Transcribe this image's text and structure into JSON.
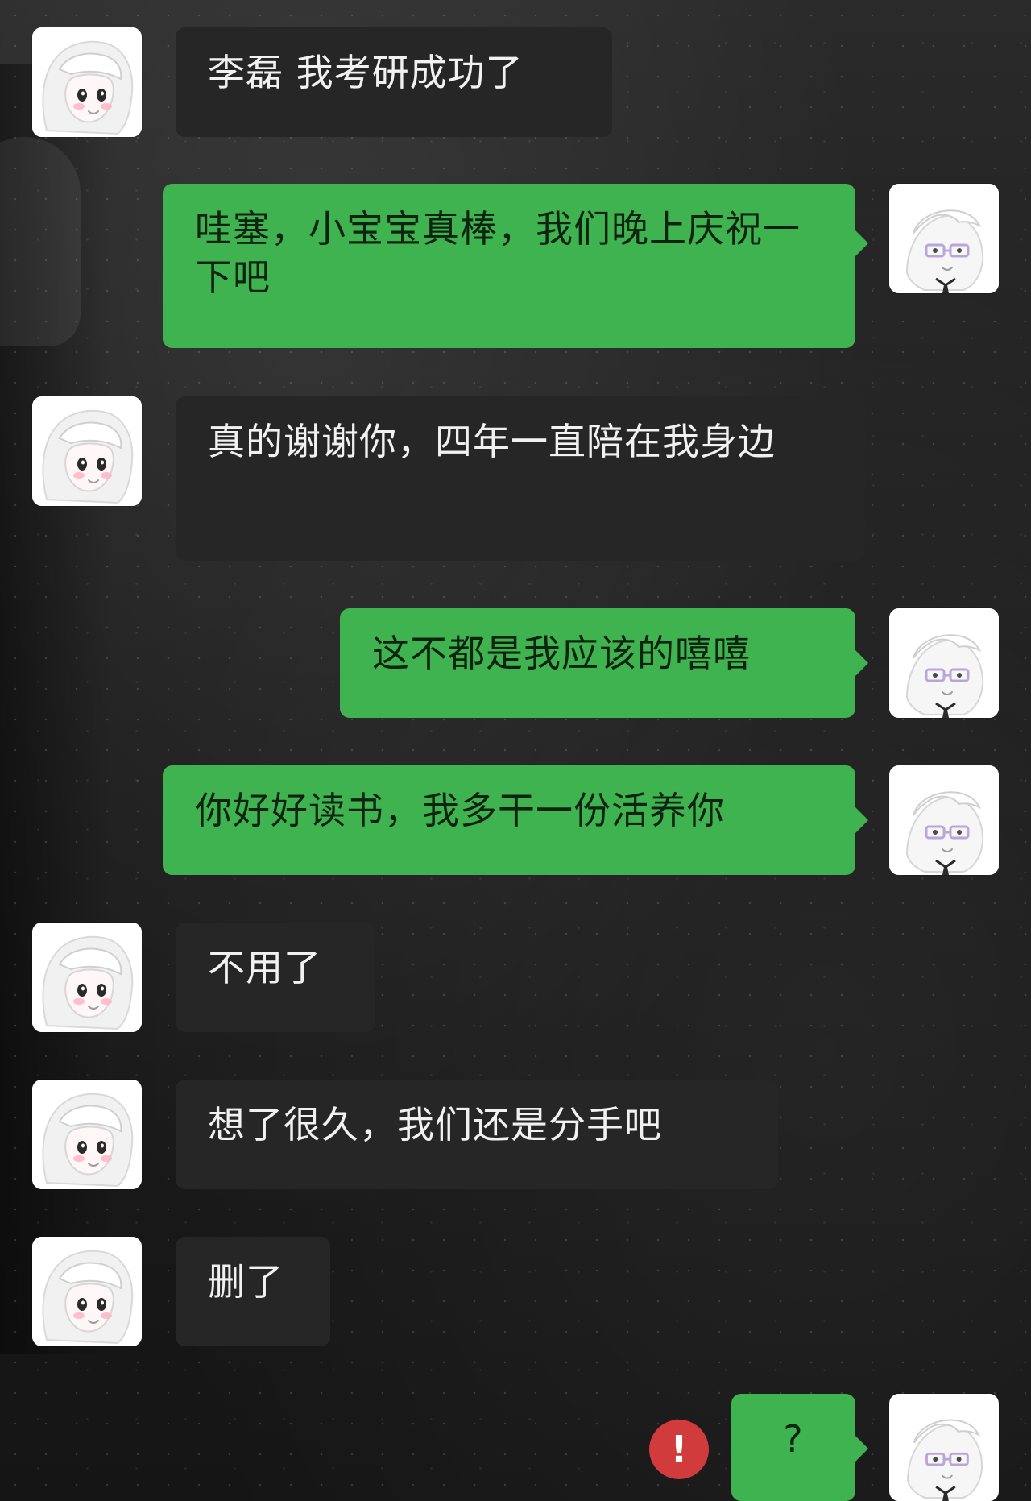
{
  "chat": {
    "messages": [
      {
        "side": "left",
        "text": "李磊 我考研成功了"
      },
      {
        "side": "right",
        "text": "哇塞，小宝宝真棒，我们晚上庆祝一下吧"
      },
      {
        "side": "left",
        "text": "真的谢谢你，四年一直陪在我身边"
      },
      {
        "side": "right",
        "text": "这不都是我应该的嘻嘻"
      },
      {
        "side": "right",
        "text": "你好好读书，我多干一份活养你"
      },
      {
        "side": "left",
        "text": "不用了"
      },
      {
        "side": "left",
        "text": "想了很久，我们还是分手吧"
      },
      {
        "side": "left",
        "text": "删了"
      },
      {
        "side": "right",
        "text": "?"
      }
    ],
    "failed_indicator": "!"
  },
  "colors": {
    "left_bubble": "#262626",
    "right_bubble": "#3fb34f",
    "error_badge": "#d23b3b"
  },
  "icons": {
    "left_avatar": "anime-girl-avatar",
    "right_avatar": "anime-boy-avatar",
    "send_failed": "exclamation-icon"
  }
}
